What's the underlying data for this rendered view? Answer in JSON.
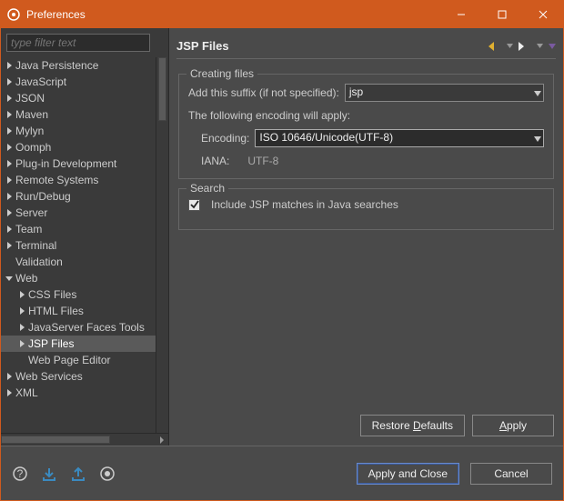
{
  "window": {
    "title": "Preferences",
    "minimize": "—",
    "maximize": "☐",
    "close": "✕"
  },
  "sidebar": {
    "filter_placeholder": "type filter text",
    "items": [
      {
        "label": "Java Persistence",
        "level": 1,
        "expanded": false
      },
      {
        "label": "JavaScript",
        "level": 1,
        "expanded": false
      },
      {
        "label": "JSON",
        "level": 1,
        "expanded": false
      },
      {
        "label": "Maven",
        "level": 1,
        "expanded": false
      },
      {
        "label": "Mylyn",
        "level": 1,
        "expanded": false
      },
      {
        "label": "Oomph",
        "level": 1,
        "expanded": false
      },
      {
        "label": "Plug-in Development",
        "level": 1,
        "expanded": false
      },
      {
        "label": "Remote Systems",
        "level": 1,
        "expanded": false
      },
      {
        "label": "Run/Debug",
        "level": 1,
        "expanded": false
      },
      {
        "label": "Server",
        "level": 1,
        "expanded": false
      },
      {
        "label": "Team",
        "level": 1,
        "expanded": false
      },
      {
        "label": "Terminal",
        "level": 1,
        "expanded": false
      },
      {
        "label": "Validation",
        "level": 1,
        "noarrow": true
      },
      {
        "label": "Web",
        "level": 1,
        "expanded": true
      },
      {
        "label": "CSS Files",
        "level": 2,
        "expanded": false
      },
      {
        "label": "HTML Files",
        "level": 2,
        "expanded": false
      },
      {
        "label": "JavaServer Faces Tools",
        "level": 2,
        "expanded": false
      },
      {
        "label": "JSP Files",
        "level": 2,
        "expanded": false,
        "selected": true
      },
      {
        "label": "Web Page Editor",
        "level": 2,
        "noarrow": true
      },
      {
        "label": "Web Services",
        "level": 1,
        "expanded": false
      },
      {
        "label": "XML",
        "level": 1,
        "expanded": false
      }
    ]
  },
  "main": {
    "title": "JSP Files",
    "creating": {
      "legend": "Creating files",
      "suffix_label": "Add this suffix (if not specified):",
      "suffix_value": "jsp",
      "encoding_note": "The following encoding will apply:",
      "encoding_label": "Encoding:",
      "encoding_value": "ISO 10646/Unicode(UTF-8)",
      "iana_label": "IANA:",
      "iana_value": "UTF-8"
    },
    "search": {
      "legend": "Search",
      "include_label": "Include JSP matches in Java searches",
      "include_checked": true
    },
    "restore_defaults": "Restore Defaults",
    "apply": "Apply"
  },
  "footer": {
    "apply_close": "Apply and Close",
    "cancel": "Cancel"
  }
}
